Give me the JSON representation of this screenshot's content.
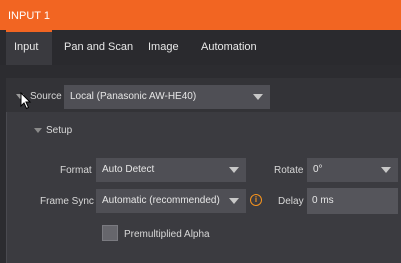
{
  "window": {
    "title": "INPUT 1"
  },
  "tabs": [
    {
      "label": "Input"
    },
    {
      "label": "Pan and Scan"
    },
    {
      "label": "Image"
    },
    {
      "label": "Automation"
    }
  ],
  "source": {
    "label": "Source",
    "value": "Local (Panasonic AW-HE40)"
  },
  "setup": {
    "label": "Setup",
    "format": {
      "label": "Format",
      "value": "Auto Detect"
    },
    "rotate": {
      "label": "Rotate",
      "value": "0°"
    },
    "frame_sync": {
      "label": "Frame Sync",
      "value": "Automatic (recommended)"
    },
    "delay": {
      "label": "Delay",
      "value": "0 ms"
    },
    "premultiplied": {
      "label": "Premultiplied Alpha",
      "checked": false
    }
  },
  "colors": {
    "accent": "#f26522",
    "info": "#f7941d",
    "panel": "#3b3b40"
  }
}
